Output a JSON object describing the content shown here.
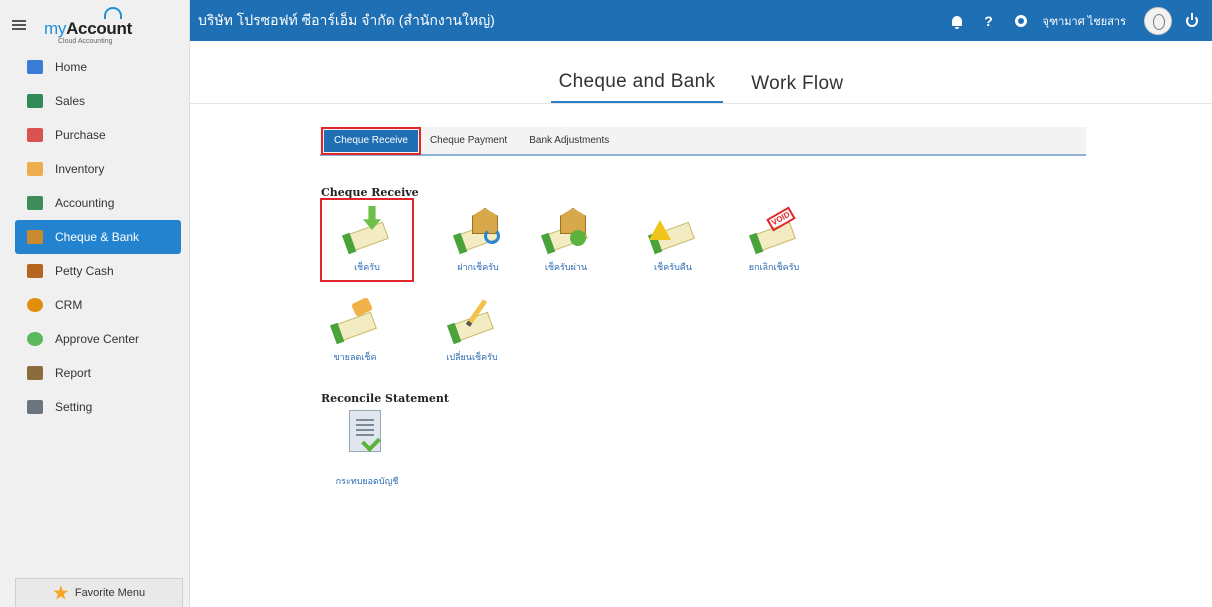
{
  "brand": {
    "name_prefix": "my",
    "name_main": "Account",
    "subtitle": "Cloud Accounting"
  },
  "topbar": {
    "company": "บริษัท โปรซอฟท์ ซีอาร์เอ็ม จำกัด (สำนักงานใหญ่)",
    "help": "?",
    "username": "จุฑามาศ ไชยสาร"
  },
  "sidebar": {
    "items": [
      {
        "label": "Home",
        "color": "#3a7bd5"
      },
      {
        "label": "Sales",
        "color": "#2e8b57"
      },
      {
        "label": "Purchase",
        "color": "#d9534f"
      },
      {
        "label": "Inventory",
        "color": "#f0ad4e"
      },
      {
        "label": "Accounting",
        "color": "#3c8d5a"
      },
      {
        "label": "Cheque & Bank",
        "color": "#c98a2e"
      },
      {
        "label": "Petty Cash",
        "color": "#b5651d"
      },
      {
        "label": "CRM",
        "color": "#e08e0b"
      },
      {
        "label": "Approve Center",
        "color": "#5cb85c"
      },
      {
        "label": "Report",
        "color": "#8a6d3b"
      },
      {
        "label": "Setting",
        "color": "#6c757d"
      }
    ],
    "active_index": 5,
    "favorite_label": "Favorite Menu"
  },
  "module_tabs": [
    "Cheque and Bank",
    "Work Flow"
  ],
  "sub_tabs": [
    "Cheque Receive",
    "Cheque Payment",
    "Bank Adjustments"
  ],
  "sections": {
    "cheque_receive": {
      "title": "Cheque Receive",
      "tiles": [
        "เช็ครับ",
        "ฝากเช็ครับ",
        "เช็ครับผ่าน",
        "เช็ครับคืน",
        "ยกเลิกเช็ครับ",
        "ขายลดเช็ค",
        "เปลี่ยนเช็ครับ"
      ]
    },
    "reconcile": {
      "title": "Reconcile Statement",
      "tiles": [
        "กระทบยอดบัญชี"
      ]
    }
  },
  "void_text": "VOID"
}
